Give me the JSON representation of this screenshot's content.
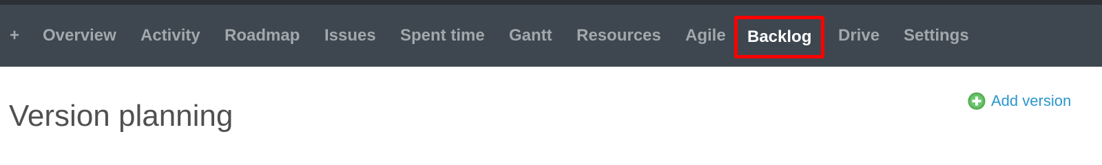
{
  "nav": {
    "plus_label": "+",
    "items": [
      {
        "label": "Overview"
      },
      {
        "label": "Activity"
      },
      {
        "label": "Roadmap"
      },
      {
        "label": "Issues"
      },
      {
        "label": "Spent time"
      },
      {
        "label": "Gantt"
      },
      {
        "label": "Resources"
      },
      {
        "label": "Agile"
      },
      {
        "label": "Backlog",
        "active": true
      },
      {
        "label": "Drive"
      },
      {
        "label": "Settings"
      }
    ]
  },
  "actions": {
    "add_version_label": "Add version",
    "add_version_icon": "plus-circle-icon"
  },
  "main": {
    "title": "Version planning"
  },
  "colors": {
    "nav_background": "#3e474f",
    "nav_text": "#a2a8ad",
    "nav_active_text": "#ffffff",
    "highlight_border": "#ff0000",
    "link": "#2996cc",
    "add_icon_green": "#5cb85c",
    "title_text": "#505050"
  }
}
